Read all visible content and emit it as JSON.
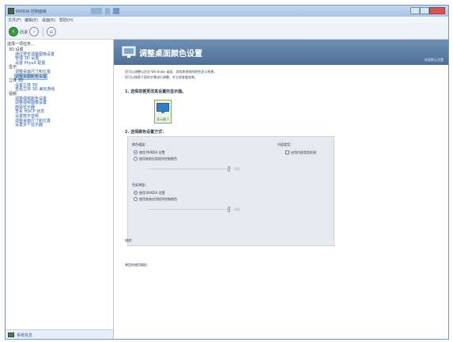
{
  "window": {
    "title": "NVIDIA 控制面板"
  },
  "menubar": {
    "items": [
      "文件(F)",
      "编辑(E)",
      "桌面(K)",
      "帮助(H)"
    ]
  },
  "toolbar": {
    "back_label": "后退"
  },
  "sidebar": {
    "title": "选择一项任务...",
    "items": [
      {
        "label": "3D 设置",
        "level": 0
      },
      {
        "label": "通过预览调整图像设置",
        "level": 1
      },
      {
        "label": "管理 3D 设置",
        "level": 1
      },
      {
        "label": "设置 PhysX 配置",
        "level": 1
      },
      {
        "label": "显示",
        "level": 0
      },
      {
        "label": "调整桌面尺寸和位置",
        "level": 1
      },
      {
        "label": "调整桌面颜色设置",
        "level": 1,
        "selected": true
      },
      {
        "label": "立体 3D",
        "level": 0
      },
      {
        "label": "设置立体 3D",
        "level": 1
      },
      {
        "label": "查看立体 3D 兼容游戏",
        "level": 1
      },
      {
        "label": "视频",
        "level": 0
      },
      {
        "label": "调整视频颜色设置",
        "level": 1
      },
      {
        "label": "调整视频图像设置",
        "level": 1
      },
      {
        "label": "旋转显示器",
        "level": 1
      },
      {
        "label": "查看 HDCP 状态",
        "level": 1
      },
      {
        "label": "设置数字音频",
        "level": 1
      },
      {
        "label": "调整桌面尺寸和位置",
        "level": 1
      },
      {
        "label": "设置多个显示器",
        "level": 1
      }
    ],
    "footer_label": "系统信息"
  },
  "main": {
    "page_title": "调整桌面颜色设置",
    "restore_link": "恢复默认设置",
    "description": [
      "您可以调整以优化 Windows 桌面、游戏和视频的颜色显示效果。",
      "您可以按照下面的步骤进行调整，并立即查看效果。"
    ],
    "section1_title": "1. 选择您要更改其设置的显示器。",
    "display_tile_label": "显示器 1",
    "section2_title": "2. 选择颜色设置方式：",
    "panel": {
      "group1_title": "颜色通道：",
      "group1_options": [
        "使用 NVIDIA 设置",
        "使用其他应用程序控制颜色"
      ],
      "group1_selected": 0,
      "group1_slider_value": "100",
      "group2_title": "内容类型：",
      "group2_checkbox_label": "启用内容类型检测",
      "group3_title": "色彩增强：",
      "group3_options": [
        "使用 NVIDIA 设置",
        "使用其他应用程序控制颜色"
      ],
      "group3_selected": 0,
      "group3_slider_value": "100"
    },
    "field_description": "描述：",
    "field_scenarios": "典型的使用情形："
  },
  "colors": {
    "banner": "#5b7ea6",
    "selection": "#c5dcf4",
    "link": "#2b5aa6",
    "nvidia_green": "#3d6f3a"
  }
}
